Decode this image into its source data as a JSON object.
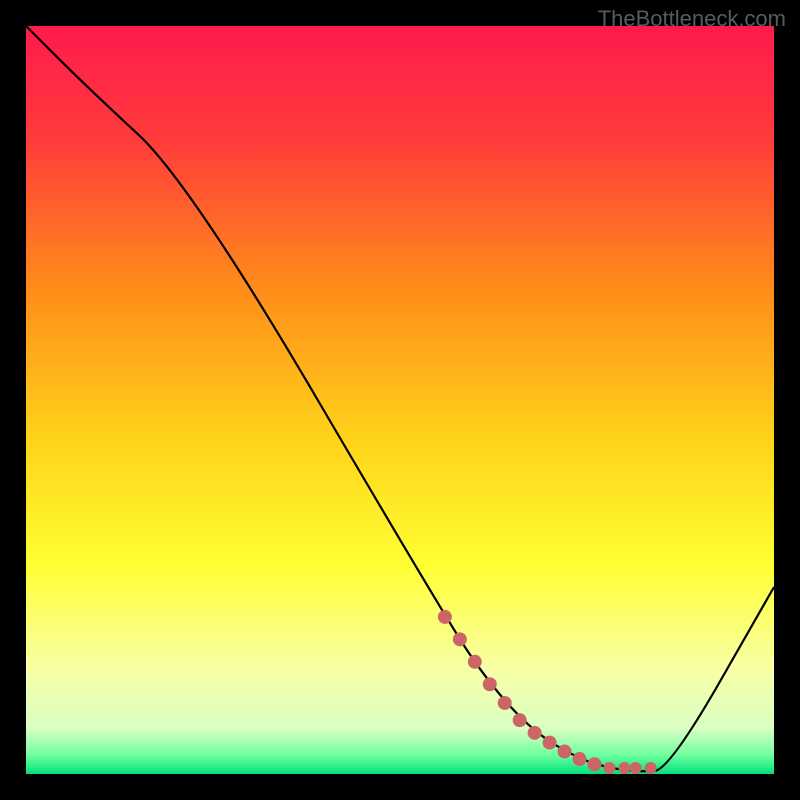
{
  "watermark": "TheBottleneck.com",
  "chart_data": {
    "type": "line",
    "title": "",
    "xlabel": "",
    "ylabel": "",
    "xlim": [
      0,
      100
    ],
    "ylim": [
      0,
      100
    ],
    "grid": false,
    "series": [
      {
        "name": "curve",
        "color": "#000000",
        "x": [
          0,
          8,
          22,
          56,
          62,
          68,
          74,
          78,
          82,
          86,
          100
        ],
        "values": [
          100,
          92,
          79,
          21,
          12,
          5.5,
          2,
          0.8,
          0.3,
          0.5,
          25
        ]
      },
      {
        "name": "dots",
        "color": "#cc6666",
        "style": "scatter",
        "x": [
          56,
          58,
          60,
          62,
          64,
          66,
          68,
          70,
          72,
          74,
          76,
          78,
          80,
          81.5,
          83.5
        ],
        "values": [
          21,
          18,
          15,
          12,
          9.5,
          7.2,
          5.5,
          4.2,
          3,
          2,
          1.3,
          0.8,
          0.8,
          0.8,
          0.8
        ]
      }
    ],
    "gradient_stops": [
      {
        "offset": 0.0,
        "color": "#ff1a4d"
      },
      {
        "offset": 0.15,
        "color": "#ff3b3b"
      },
      {
        "offset": 0.35,
        "color": "#ff8c1a"
      },
      {
        "offset": 0.55,
        "color": "#ffd21a"
      },
      {
        "offset": 0.72,
        "color": "#ffff33"
      },
      {
        "offset": 0.86,
        "color": "#f7ffa6"
      },
      {
        "offset": 0.94,
        "color": "#d9ffc2"
      },
      {
        "offset": 0.975,
        "color": "#6eff9e"
      },
      {
        "offset": 1.0,
        "color": "#00e07e"
      }
    ]
  }
}
